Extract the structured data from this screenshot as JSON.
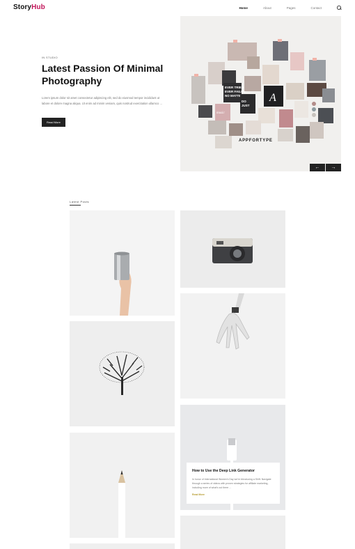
{
  "header": {
    "logo_main": "Story",
    "logo_accent": "Hub",
    "nav": [
      {
        "label": "Home",
        "active": true
      },
      {
        "label": "About",
        "active": false
      },
      {
        "label": "Pages",
        "active": false
      },
      {
        "label": "Contact",
        "active": false
      }
    ],
    "search_icon": "search-icon"
  },
  "hero": {
    "category": "IN STUDIO",
    "title": "Latest Passion Of Minimal Photography",
    "excerpt": "Lorem ipsum dolor sit amet consectetur adipiscing elit, sed do eiusmod tempor incididunt ut labore et dolore magna aliqua. Ut enim ad minim veniam, quis nostrud exercitation ullamco ...",
    "read_more": "Read More",
    "image_label": "APPFORTYPE",
    "prev_icon": "arrow-left-icon",
    "next_icon": "arrow-right-icon",
    "prev_glyph": "←",
    "next_glyph": "→"
  },
  "latest": {
    "title": "Latest Posts",
    "featured_post": {
      "title": "How to Use the Deep Link Generator",
      "excerpt": "In honor of International Women's Day we're introducing a Shift: Navigate through a series of videos with proven strategies for affiliate marketing, including more of what's out there ...",
      "link": "Read More"
    }
  },
  "colors": {
    "accent": "#c2185b",
    "dark": "#222222",
    "link": "#b59a2d"
  }
}
